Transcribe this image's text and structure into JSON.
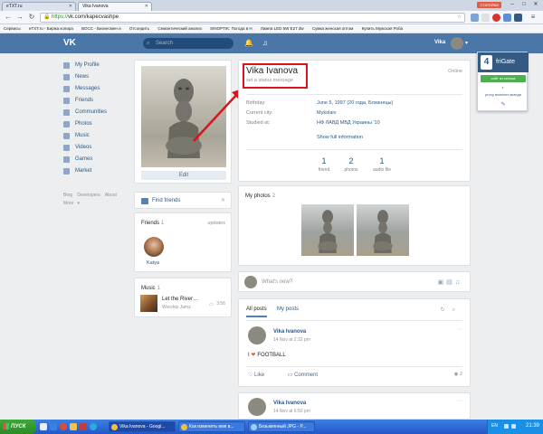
{
  "browser": {
    "tabs": [
      {
        "label": "eTXT.ru"
      },
      {
        "label": "Vika Ivanova"
      }
    ],
    "window_badge": "СТАТЕЙКИ",
    "url_scheme": "https://",
    "url_rest": "vk.com/kapecvashpe",
    "bookmarks": [
      "Сервисы",
      "eTXT.ru - Биржа копира",
      "ВОСС - Бизнесмен и",
      "Отсоедить",
      "Семантический анализ",
      "SINOPTIK: Погода в Н",
      "Лампа LED 5W E27 dw",
      "Сумка женская оптом",
      "Купить Мужская Роба"
    ]
  },
  "vk_header": {
    "logo": "VK",
    "search_placeholder": "Search",
    "user_name": "Vika"
  },
  "left_menu": {
    "items": [
      {
        "label": "My Profile"
      },
      {
        "label": "News"
      },
      {
        "label": "Messages"
      },
      {
        "label": "Friends"
      },
      {
        "label": "Communities"
      },
      {
        "label": "Photos"
      },
      {
        "label": "Music"
      },
      {
        "label": "Videos"
      },
      {
        "label": "Games"
      },
      {
        "label": "Market"
      }
    ],
    "footer": [
      "Blog",
      "Developers",
      "About",
      "More"
    ]
  },
  "profile_photo": {
    "edit_label": "Edit"
  },
  "find_friends": {
    "label": "Find friends"
  },
  "friends": {
    "title": "Friends",
    "count": "1",
    "updates": "updates",
    "friend_name": "Katya"
  },
  "music": {
    "title": "Music",
    "count": "1",
    "track_title": "Let the River…",
    "track_artist": "Worship Jamz",
    "duration": "3:56"
  },
  "profile": {
    "name": "Vika Ivanova",
    "status_placeholder": "set a status message",
    "online": "Online",
    "fields": [
      {
        "label": "Birthday:",
        "value": "June 5, 1997 (20 года, Близнецы)"
      },
      {
        "label": "Current city:",
        "value": "Mykolaiv"
      },
      {
        "label": "Studied at:",
        "value": "НФ ЛАВД МВД Украины '10"
      }
    ],
    "show_full": "Show full information",
    "stats": [
      {
        "num": "1",
        "label": "friend"
      },
      {
        "num": "2",
        "label": "photos"
      },
      {
        "num": "1",
        "label": "audio file"
      }
    ]
  },
  "photos": {
    "title": "My photos",
    "count": "2"
  },
  "whats_new": {
    "placeholder": "What's new?"
  },
  "feed": {
    "tabs": [
      {
        "label": "All posts"
      },
      {
        "label": "My posts"
      }
    ],
    "post1": {
      "author": "Vika Ivanova",
      "date": "14 Nov at 2:32 pm",
      "text_prefix": "I",
      "text": "FOOTBALL",
      "like": "Like",
      "comment": "Comment",
      "views": "2"
    },
    "post2": {
      "author": "Vika Ivanova",
      "date": "14 Nov at 6:50 pm"
    }
  },
  "frigate": {
    "name": "friGate",
    "button": "сайт из списка",
    "item1": "proxy включен всегда"
  },
  "taskbar": {
    "start": "ПУСК",
    "tasks": [
      {
        "label": "Vika Ivanova - Googl..."
      },
      {
        "label": "Как изменить имя в..."
      },
      {
        "label": "Безымянный JPG - P..."
      }
    ],
    "lang": "EN",
    "clock": "21:39"
  },
  "colors": {
    "vk_blue": "#4a76a8",
    "link": "#2a5885",
    "highlight_red": "#d8141c",
    "background": "#edeef0"
  }
}
